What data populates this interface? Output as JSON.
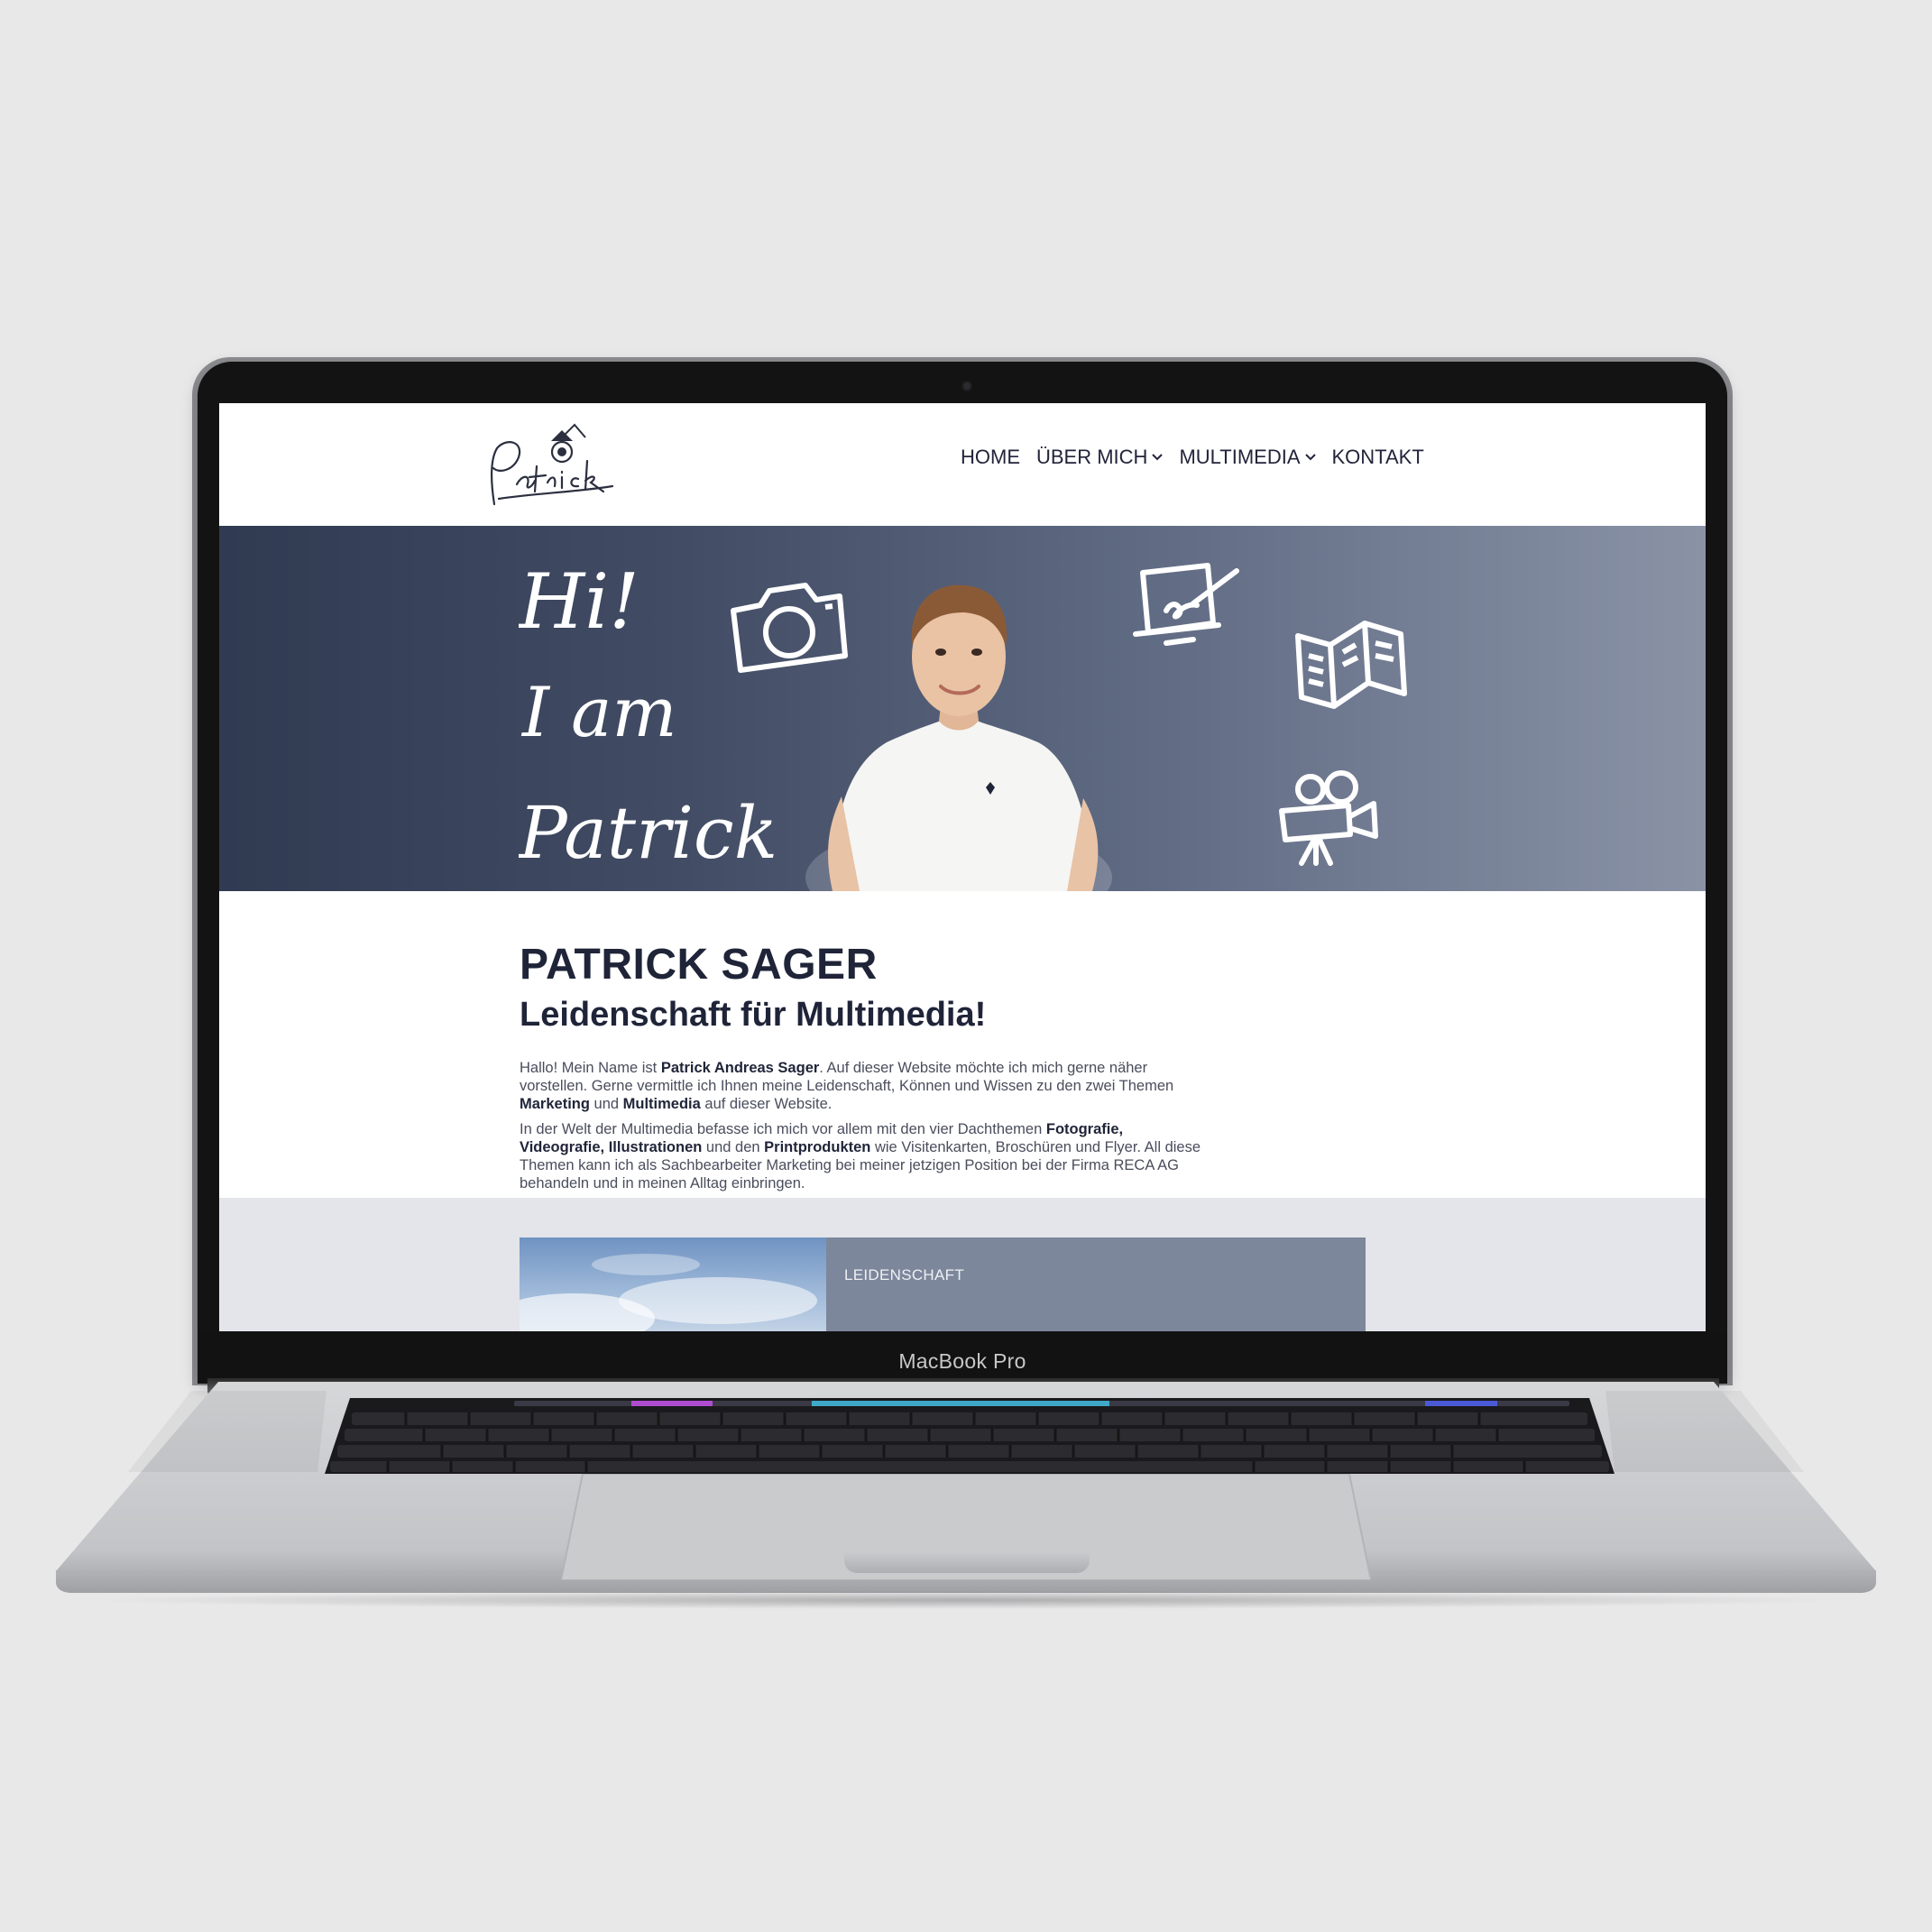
{
  "device": {
    "model_label": "MacBook Pro"
  },
  "site": {
    "logo_text": "Patrick",
    "nav": [
      {
        "label": "HOME",
        "has_dropdown": false
      },
      {
        "label": "ÜBER MICH",
        "has_dropdown": true
      },
      {
        "label": "MULTIMEDIA",
        "has_dropdown": true
      },
      {
        "label": "KONTAKT",
        "has_dropdown": false
      }
    ],
    "hero": {
      "script_lines": [
        "Hi!",
        "I am",
        "Patrick"
      ],
      "icons": [
        "camera-icon",
        "tablet-drawing-icon",
        "brochure-icon",
        "video-camera-icon"
      ]
    },
    "intro": {
      "title": "PATRICK SAGER",
      "subtitle": "Leidenschaft für Multimedia!",
      "p1": {
        "t1": "Hallo! Mein Name ist ",
        "b1": "Patrick Andreas Sager",
        "t2": ". Auf dieser Website möchte ich mich gerne näher vorstellen. Gerne vermittle ich Ihnen meine Leidenschaft, Können und Wissen zu den zwei Themen ",
        "b2": "Marketing",
        "t3": " und ",
        "b3": "Multimedia",
        "t4": " auf dieser Website."
      },
      "p2": {
        "t1": "In der Welt der Multimedia befasse ich mich vor allem mit den vier Dachthemen ",
        "b1": "Fotografie, Videografie, Illustrationen",
        "t2": " und den ",
        "b2": "Printprodukten",
        "t3": " wie Visitenkarten, Broschüren und Flyer. All diese Themen kann ich als Sachbearbeiter Marketing bei meiner jetzigen Position bei der Firma RECA AG behandeln und in meinen Alltag einbringen."
      }
    },
    "feature": {
      "label": "LEIDENSCHAFT"
    }
  },
  "colors": {
    "page_background": "#e8e8e9",
    "heading_navy": "#1f2438",
    "hero_dark": "#303a51",
    "hero_light": "#8a93a6",
    "feature_card": "#7d879b"
  }
}
